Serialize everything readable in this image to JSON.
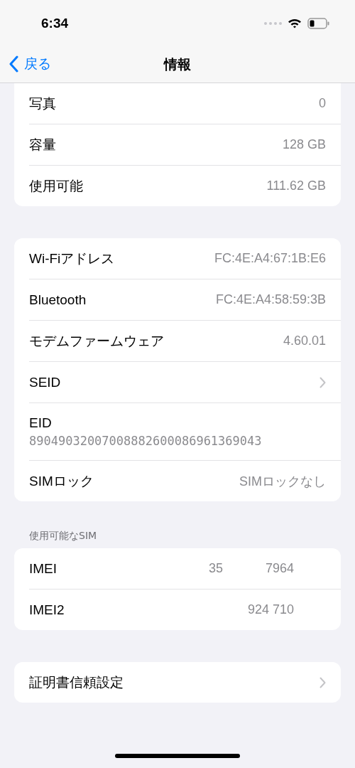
{
  "status_bar": {
    "time": "6:34"
  },
  "nav": {
    "back": "戻る",
    "title": "情報"
  },
  "groups": [
    {
      "rows": [
        {
          "kind": "value",
          "label": "写真",
          "value": "0"
        },
        {
          "kind": "value",
          "label": "容量",
          "value": "128 GB"
        },
        {
          "kind": "value",
          "label": "使用可能",
          "value": "111.62 GB"
        }
      ]
    },
    {
      "rows": [
        {
          "kind": "value",
          "label": "Wi-Fiアドレス",
          "value": "FC:4E:A4:67:1B:E6"
        },
        {
          "kind": "value",
          "label": "Bluetooth",
          "value": "FC:4E:A4:58:59:3B"
        },
        {
          "kind": "value",
          "label": "モデムファームウェア",
          "value": "4.60.01"
        },
        {
          "kind": "chevron",
          "label": "SEID"
        },
        {
          "kind": "stacked",
          "label": "EID",
          "value": "89049032007008882600086961369043"
        },
        {
          "kind": "value",
          "label": "SIMロック",
          "value": "SIMロックなし"
        }
      ]
    },
    {
      "header": "使用可能なSIM",
      "rows": [
        {
          "kind": "split",
          "label": "IMEI",
          "parts": [
            "35",
            "7964"
          ]
        },
        {
          "kind": "split",
          "label": "IMEI2",
          "parts": [
            "924 710"
          ]
        }
      ]
    },
    {
      "rows": [
        {
          "kind": "chevron",
          "label": "証明書信頼設定"
        }
      ]
    }
  ]
}
